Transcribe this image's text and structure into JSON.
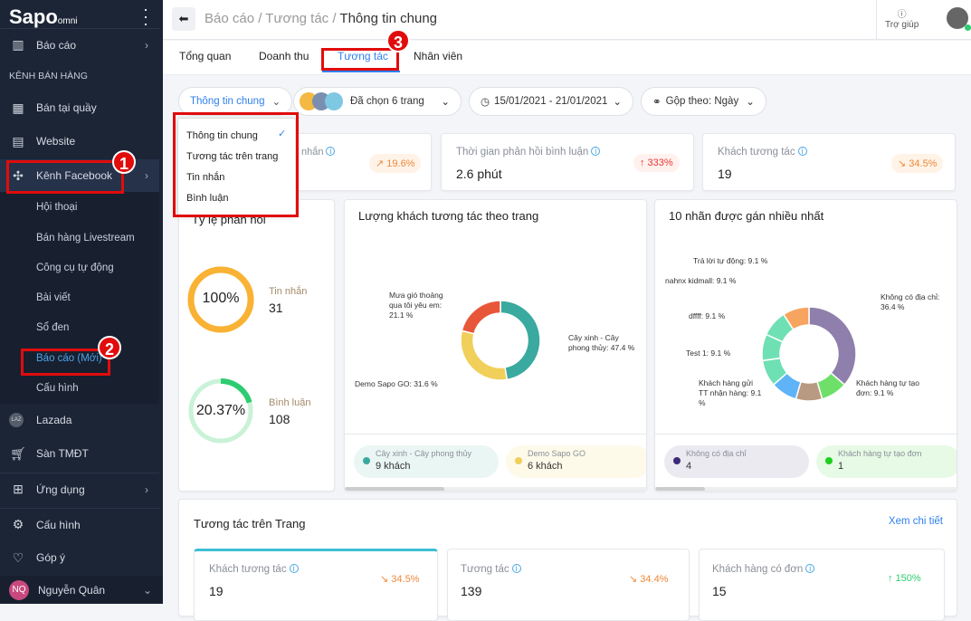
{
  "sidebar": {
    "logo": "Sapo",
    "logo_sub": "omni",
    "report": "Báo cáo",
    "section": "KÊNH BÁN HÀNG",
    "pos": "Bán tại quầy",
    "website": "Website",
    "facebook": "Kênh Facebook",
    "sub": [
      "Hội thoại",
      "Bán hàng Livestream",
      "Công cụ tự động",
      "Bài viết",
      "Sổ đen",
      "Báo cáo (Mới)",
      "Cấu hình"
    ],
    "lazada": "Lazada",
    "lazada_icon": "LAZ",
    "tmdt": "Sàn TMĐT",
    "apps": "Ứng dụng",
    "settings": "Cấu hình",
    "feedback": "Góp ý",
    "user_initials": "NQ",
    "user": "Nguyễn Quân"
  },
  "badges": [
    "1",
    "2",
    "3"
  ],
  "header": {
    "crumb1": "Báo cáo",
    "crumb2": "Tương tác",
    "crumb3": "Thông tin chung",
    "sep": " / ",
    "help": "Trợ giúp"
  },
  "tabs": [
    "Tổng quan",
    "Doanh thu",
    "Tương tác",
    "Nhân viên"
  ],
  "filters": {
    "view": "Thông tin chung",
    "pages": "Đã chọn 6 trang",
    "date": "15/01/2021 - 21/01/2021",
    "group": "Gộp theo: Ngày"
  },
  "dropdown": [
    "Thông tin chung",
    "Tương tác trên trang",
    "Tin nhắn",
    "Bình luận"
  ],
  "stats": [
    {
      "label": "nhắn",
      "change": "↗ 19.6%"
    },
    {
      "label": "Thời gian phản hồi bình luận",
      "value": "2.6 phút",
      "change": "↑ 333%"
    },
    {
      "label": "Khách tương tác",
      "value": "19",
      "change": "↘ 34.5%"
    }
  ],
  "rate": {
    "title": "Tỷ lệ phản hồi",
    "msg_pct": "100%",
    "msg_label": "Tin nhắn",
    "msg_val": "31",
    "msg_frac": 1.0,
    "cmt_pct": "20.37%",
    "cmt_label": "Bình luận",
    "cmt_val": "108",
    "cmt_frac": 0.2037
  },
  "colors": {
    "accent": "#2f80ed",
    "red": "#e10c0c",
    "sidebar": "#1c2536"
  },
  "chart1": {
    "title": "Lượng khách tương tác theo trang",
    "slices": [
      {
        "name": "Cây xinh - Cây phong thủy",
        "label": "Cây xinh - Cây phong thủy: 47.4 %",
        "value": 47.4,
        "color": "#3aa99f"
      },
      {
        "name": "Demo Sapo GO",
        "label": "Demo Sapo GO: 31.6 %",
        "value": 31.6,
        "color": "#f0cf5a"
      },
      {
        "name": "Mưa gió thoảng qua tôi yêu em",
        "label": "Mưa gió thoảng qua tôi yêu em: 21.1 %",
        "value": 21.1,
        "color": "#e8563a"
      }
    ],
    "legend": [
      {
        "name": "Cây xinh - Cây phong thủy",
        "value": "9 khách"
      },
      {
        "name": "Demo Sapo GO",
        "value": "6 khách"
      }
    ]
  },
  "chart2": {
    "title": "10 nhãn được gán nhiều nhất",
    "slices": [
      {
        "label": "Không có địa chỉ: 36.4 %",
        "value": 36.4,
        "color": "#8e7fac"
      },
      {
        "label": "Khách hàng tự tạo đơn: 9.1 %",
        "value": 9.1,
        "color": "#6ee06a"
      },
      {
        "label": "",
        "value": 9.1,
        "color": "#b89a80"
      },
      {
        "label": "Khách hàng gửi TT nhận hàng: 9.1 %",
        "value": 9.1,
        "color": "#5fb3f7"
      },
      {
        "label": "Test 1: 9.1 %",
        "value": 9.1,
        "color": "#6fe0b4"
      },
      {
        "label": "dffff: 9.1 %",
        "value": 9.1,
        "color": "#6fe0b4"
      },
      {
        "label": "nahnx kidmall: 9.1 %",
        "value": 9.1,
        "color": "#6fe0b4"
      },
      {
        "label": "Trả lời tự động: 9.1 %",
        "value": 9.1,
        "color": "#f6a460"
      }
    ],
    "legend": [
      {
        "name": "Không có địa chỉ",
        "value": "4"
      },
      {
        "name": "Khách hàng tự tạo đơn",
        "value": "1"
      }
    ]
  },
  "page_section": {
    "title": "Tương tác trên Trang",
    "link": "Xem chi tiết",
    "cards": [
      {
        "label": "Khách tương tác",
        "value": "19",
        "change": "↘ 34.5%"
      },
      {
        "label": "Tương tác",
        "value": "139",
        "change": "↘ 34.4%"
      },
      {
        "label": "Khách hàng có đơn",
        "value": "15",
        "change": "↑ 150%"
      }
    ]
  }
}
